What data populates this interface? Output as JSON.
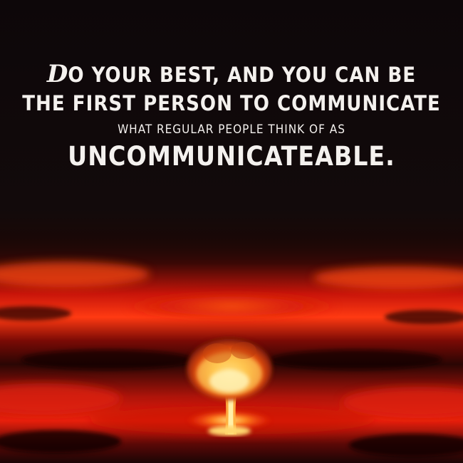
{
  "quote": {
    "line1_cap": "D",
    "line1_rest": "o your best, and you can be",
    "line2": "the first person to communicate",
    "line3": "what regular people think of as",
    "line4": "uncommunicateable."
  },
  "colors": {
    "background": "#0c0708",
    "text": "#f4f1ee",
    "fire_red": "#d21408",
    "fire_orange": "#ff6a10",
    "fire_core": "#fff2a0"
  },
  "icons": [
    "nuclear-mushroom-cloud-illustration"
  ]
}
